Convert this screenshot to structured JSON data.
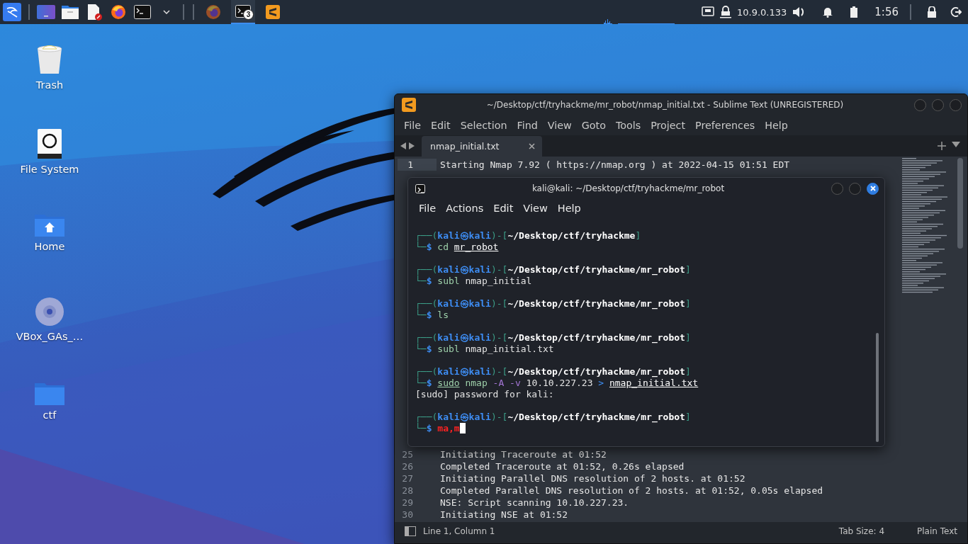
{
  "taskbar": {
    "tasks": [
      {
        "kind": "browser",
        "selected": false
      },
      {
        "kind": "terminal",
        "selected": true,
        "badge": "3"
      },
      {
        "kind": "editor",
        "selected": false
      }
    ],
    "ip": "10.9.0.133",
    "clock": "1:56"
  },
  "desktop_icons": [
    {
      "kind": "trash",
      "label": "Trash"
    },
    {
      "kind": "drive",
      "label": "File System"
    },
    {
      "kind": "home",
      "label": "Home"
    },
    {
      "kind": "disc",
      "label": "VBox_GAs_…"
    },
    {
      "kind": "folder",
      "label": "ctf"
    }
  ],
  "editor_window": {
    "title": "~/Desktop/ctf/tryhackme/mr_robot/nmap_initial.txt - Sublime Text (UNREGISTERED)",
    "menu": [
      "File",
      "Edit",
      "Selection",
      "Find",
      "View",
      "Goto",
      "Tools",
      "Project",
      "Preferences",
      "Help"
    ],
    "tabs": [
      {
        "label": "nmap_initial.txt",
        "selected": true
      }
    ],
    "head_lines": [
      {
        "number": "1",
        "text": "Starting Nmap 7.92 ( https://nmap.org ) at 2022-04-15 01:51 EDT",
        "current": true
      }
    ],
    "tail_lines": [
      {
        "number": "25",
        "text": "Initiating Traceroute at 01:52",
        "current": false
      },
      {
        "number": "26",
        "text": "Completed Traceroute at 01:52, 0.26s elapsed",
        "current": false
      },
      {
        "number": "27",
        "text": "Initiating Parallel DNS resolution of 2 hosts. at 01:52",
        "current": false
      },
      {
        "number": "28",
        "text": "Completed Parallel DNS resolution of 2 hosts. at 01:52, 0.05s elapsed",
        "current": false
      },
      {
        "number": "29",
        "text": "NSE: Script scanning 10.10.227.23.",
        "current": false
      },
      {
        "number": "30",
        "text": "Initiating NSE at 01:52",
        "current": false
      }
    ],
    "status": {
      "position": "Line 1, Column 1",
      "tab_size": "Tab Size: 4",
      "syntax": "Plain Text"
    }
  },
  "terminal_window": {
    "title": "kali@kali: ~/Desktop/ctf/tryhackme/mr_robot",
    "menu": [
      "File",
      "Actions",
      "Edit",
      "View",
      "Help"
    ],
    "lines": [
      {
        "kind": "prompt",
        "segments": [
          {
            "text": "┌──(",
            "kind": "frame"
          },
          {
            "text": "kali㉿kali",
            "kind": "user"
          },
          {
            "text": ")-[",
            "kind": "frame"
          },
          {
            "text": "~/Desktop/ctf/tryhackme",
            "kind": "path"
          },
          {
            "text": "]",
            "kind": "frame"
          }
        ]
      },
      {
        "kind": "command",
        "segments": [
          {
            "text": "└─",
            "kind": "frame"
          },
          {
            "text": "$ ",
            "kind": "dollar"
          },
          {
            "text": "cd ",
            "kind": "cmd"
          },
          {
            "text": "mr_robot",
            "kind": "link"
          }
        ]
      },
      {
        "kind": "prompt",
        "segments": [
          {
            "text": "┌──(",
            "kind": "frame"
          },
          {
            "text": "kali㉿kali",
            "kind": "user"
          },
          {
            "text": ")-[",
            "kind": "frame"
          },
          {
            "text": "~/Desktop/ctf/tryhackme/mr_robot",
            "kind": "path"
          },
          {
            "text": "]",
            "kind": "frame"
          }
        ]
      },
      {
        "kind": "command",
        "segments": [
          {
            "text": "└─",
            "kind": "frame"
          },
          {
            "text": "$ ",
            "kind": "dollar"
          },
          {
            "text": "subl ",
            "kind": "cmd"
          },
          {
            "text": "nmap_initial",
            "kind": "plain"
          }
        ]
      },
      {
        "kind": "prompt",
        "segments": [
          {
            "text": "┌──(",
            "kind": "frame"
          },
          {
            "text": "kali㉿kali",
            "kind": "user"
          },
          {
            "text": ")-[",
            "kind": "frame"
          },
          {
            "text": "~/Desktop/ctf/tryhackme/mr_robot",
            "kind": "path"
          },
          {
            "text": "]",
            "kind": "frame"
          }
        ]
      },
      {
        "kind": "command",
        "segments": [
          {
            "text": "└─",
            "kind": "frame"
          },
          {
            "text": "$ ",
            "kind": "dollar"
          },
          {
            "text": "ls",
            "kind": "cmd"
          }
        ]
      },
      {
        "kind": "prompt",
        "segments": [
          {
            "text": "┌──(",
            "kind": "frame"
          },
          {
            "text": "kali㉿kali",
            "kind": "user"
          },
          {
            "text": ")-[",
            "kind": "frame"
          },
          {
            "text": "~/Desktop/ctf/tryhackme/mr_robot",
            "kind": "path"
          },
          {
            "text": "]",
            "kind": "frame"
          }
        ]
      },
      {
        "kind": "command",
        "segments": [
          {
            "text": "└─",
            "kind": "frame"
          },
          {
            "text": "$ ",
            "kind": "dollar"
          },
          {
            "text": "subl ",
            "kind": "cmd"
          },
          {
            "text": "nmap_initial.txt",
            "kind": "plain"
          }
        ]
      },
      {
        "kind": "prompt",
        "segments": [
          {
            "text": "┌──(",
            "kind": "frame"
          },
          {
            "text": "kali㉿kali",
            "kind": "user"
          },
          {
            "text": ")-[",
            "kind": "frame"
          },
          {
            "text": "~/Desktop/ctf/tryhackme/mr_robot",
            "kind": "path"
          },
          {
            "text": "]",
            "kind": "frame"
          }
        ]
      },
      {
        "kind": "command",
        "segments": [
          {
            "text": "└─",
            "kind": "frame"
          },
          {
            "text": "$ ",
            "kind": "dollar"
          },
          {
            "text": "sudo",
            "kind": "cmdlink"
          },
          {
            "text": " nmap ",
            "kind": "cmd"
          },
          {
            "text": "-A -v",
            "kind": "option"
          },
          {
            "text": " 10.10.227.23 ",
            "kind": "plain"
          },
          {
            "text": "> ",
            "kind": "redirect"
          },
          {
            "text": "nmap_initial.txt",
            "kind": "link"
          }
        ]
      },
      {
        "kind": "output",
        "segments": [
          {
            "text": "[sudo] password for kali:",
            "kind": "plain"
          }
        ]
      },
      {
        "kind": "prompt",
        "segments": [
          {
            "text": "┌──(",
            "kind": "frame"
          },
          {
            "text": "kali㉿kali",
            "kind": "user"
          },
          {
            "text": ")-[",
            "kind": "frame"
          },
          {
            "text": "~/Desktop/ctf/tryhackme/mr_robot",
            "kind": "path"
          },
          {
            "text": "]",
            "kind": "frame"
          }
        ]
      },
      {
        "kind": "command",
        "cursor": true,
        "segments": [
          {
            "text": "└─",
            "kind": "frame"
          },
          {
            "text": "$ ",
            "kind": "dollar"
          },
          {
            "text": "ma,m",
            "kind": "error"
          }
        ]
      }
    ]
  }
}
